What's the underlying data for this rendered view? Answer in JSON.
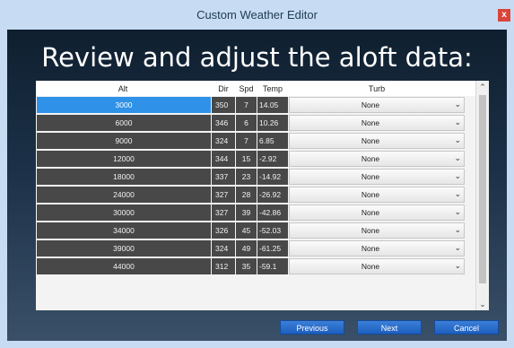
{
  "window": {
    "title": "Custom Weather Editor",
    "close_glyph": "x"
  },
  "heading": "Review and adjust the aloft data:",
  "table": {
    "headers": {
      "alt": "Alt",
      "dir": "Dir",
      "spd": "Spd",
      "temp": "Temp",
      "turb": "Turb"
    },
    "rows": [
      {
        "alt": "3000",
        "dir": "350",
        "spd": "7",
        "temp": "14.05",
        "turb": "None",
        "selected": true
      },
      {
        "alt": "6000",
        "dir": "346",
        "spd": "6",
        "temp": "10.26",
        "turb": "None"
      },
      {
        "alt": "9000",
        "dir": "324",
        "spd": "7",
        "temp": "6.85",
        "turb": "None"
      },
      {
        "alt": "12000",
        "dir": "344",
        "spd": "15",
        "temp": "-2.92",
        "turb": "None"
      },
      {
        "alt": "18000",
        "dir": "337",
        "spd": "23",
        "temp": "-14.92",
        "turb": "None"
      },
      {
        "alt": "24000",
        "dir": "327",
        "spd": "28",
        "temp": "-26.92",
        "turb": "None"
      },
      {
        "alt": "30000",
        "dir": "327",
        "spd": "39",
        "temp": "-42.86",
        "turb": "None"
      },
      {
        "alt": "34000",
        "dir": "326",
        "spd": "45",
        "temp": "-52.03",
        "turb": "None"
      },
      {
        "alt": "39000",
        "dir": "324",
        "spd": "49",
        "temp": "-61.25",
        "turb": "None"
      },
      {
        "alt": "44000",
        "dir": "312",
        "spd": "35",
        "temp": "-59.1",
        "turb": "None"
      }
    ]
  },
  "buttons": {
    "previous": "Previous",
    "next": "Next",
    "cancel": "Cancel"
  },
  "colors": {
    "selection": "#2f92e8",
    "button": "#2a6fd0",
    "close": "#d9453b"
  }
}
